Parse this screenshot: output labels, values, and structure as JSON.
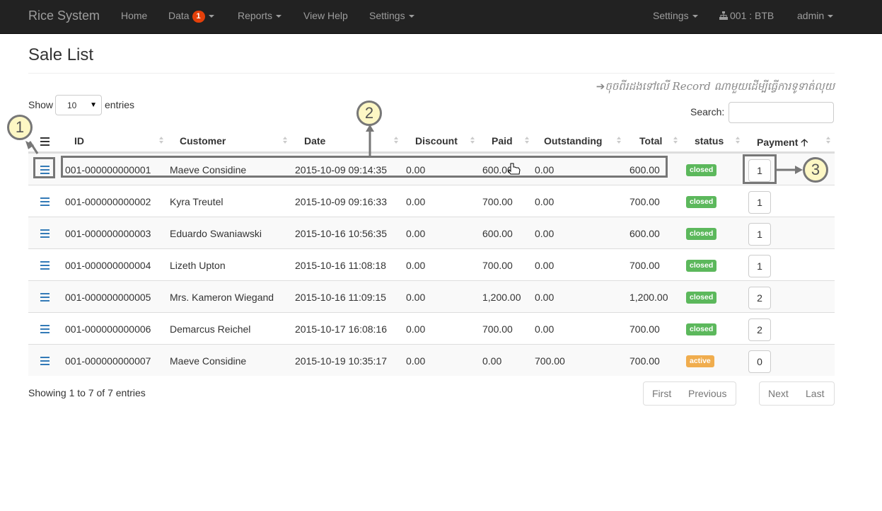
{
  "navbar": {
    "brand": "Rice System",
    "home": "Home",
    "data": "Data",
    "data_badge": "1",
    "reports": "Reports",
    "view_help": "View Help",
    "settings_left": "Settings",
    "settings_right": "Settings",
    "branch": "001 : BTB",
    "user": "admin"
  },
  "page": {
    "title": "Sale List",
    "hint_text": "ចុចពីរដងទៅលើ Record ណាមួយដើម្បីធ្វើការទូទាត់លុយ"
  },
  "controls": {
    "show_label": "Show",
    "entries_value": "10",
    "entries_label": "entries",
    "search_label": "Search:",
    "search_value": ""
  },
  "table": {
    "columns": [
      "ID",
      "Customer",
      "Date",
      "Discount",
      "Paid",
      "Outstanding",
      "Total",
      "status",
      "Payment"
    ],
    "rows": [
      {
        "id": "001-000000000001",
        "customer": "Maeve Considine",
        "date": "2015-10-09 09:14:35",
        "discount": "0.00",
        "paid": "600.00",
        "outstanding": "0.00",
        "total": "600.00",
        "status": "closed",
        "payment": "1"
      },
      {
        "id": "001-000000000002",
        "customer": "Kyra Treutel",
        "date": "2015-10-09 09:16:33",
        "discount": "0.00",
        "paid": "700.00",
        "outstanding": "0.00",
        "total": "700.00",
        "status": "closed",
        "payment": "1"
      },
      {
        "id": "001-000000000003",
        "customer": "Eduardo Swaniawski",
        "date": "2015-10-16 10:56:35",
        "discount": "0.00",
        "paid": "600.00",
        "outstanding": "0.00",
        "total": "600.00",
        "status": "closed",
        "payment": "1"
      },
      {
        "id": "001-000000000004",
        "customer": "Lizeth Upton",
        "date": "2015-10-16 11:08:18",
        "discount": "0.00",
        "paid": "700.00",
        "outstanding": "0.00",
        "total": "700.00",
        "status": "closed",
        "payment": "1"
      },
      {
        "id": "001-000000000005",
        "customer": "Mrs. Kameron Wiegand",
        "date": "2015-10-16 11:09:15",
        "discount": "0.00",
        "paid": "1,200.00",
        "outstanding": "0.00",
        "total": "1,200.00",
        "status": "closed",
        "payment": "2"
      },
      {
        "id": "001-000000000006",
        "customer": "Demarcus Reichel",
        "date": "2015-10-17 16:08:16",
        "discount": "0.00",
        "paid": "700.00",
        "outstanding": "0.00",
        "total": "700.00",
        "status": "closed",
        "payment": "2"
      },
      {
        "id": "001-000000000007",
        "customer": "Maeve Considine",
        "date": "2015-10-19 10:35:17",
        "discount": "0.00",
        "paid": "0.00",
        "outstanding": "700.00",
        "total": "700.00",
        "status": "active",
        "payment": "0"
      }
    ]
  },
  "footer": {
    "info": "Showing 1 to 7 of 7 entries",
    "first": "First",
    "previous": "Previous",
    "next": "Next",
    "last": "Last"
  },
  "annotations": [
    "1",
    "2",
    "3"
  ],
  "colors": {
    "navbar_bg": "#222222",
    "status_closed": "#5cb85c",
    "status_active": "#f0ad4e",
    "badge": "#e4400a",
    "link": "#337ab7"
  },
  "icons": [
    "sitemap-icon",
    "arrow-right-icon",
    "menu-icon",
    "sort-icon",
    "sort-asc-icon",
    "hand-cursor-icon"
  ]
}
